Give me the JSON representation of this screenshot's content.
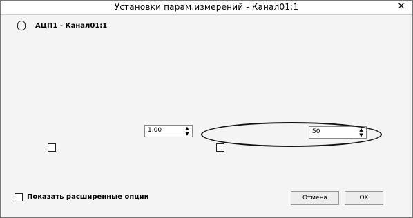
{
  "window": {
    "title": "Установки парам.измерений - Канал01:1",
    "close_glyph": "✕"
  },
  "header": {
    "channel": "АЦП1 - Канал01:1"
  },
  "spin_primary": {
    "value": "1.00"
  },
  "spin_secondary": {
    "value": "50"
  },
  "footer": {
    "checkbox_label": "Показать расширенные опции"
  },
  "buttons": {
    "cancel_label": "Отмена",
    "ok_label": "OK"
  }
}
